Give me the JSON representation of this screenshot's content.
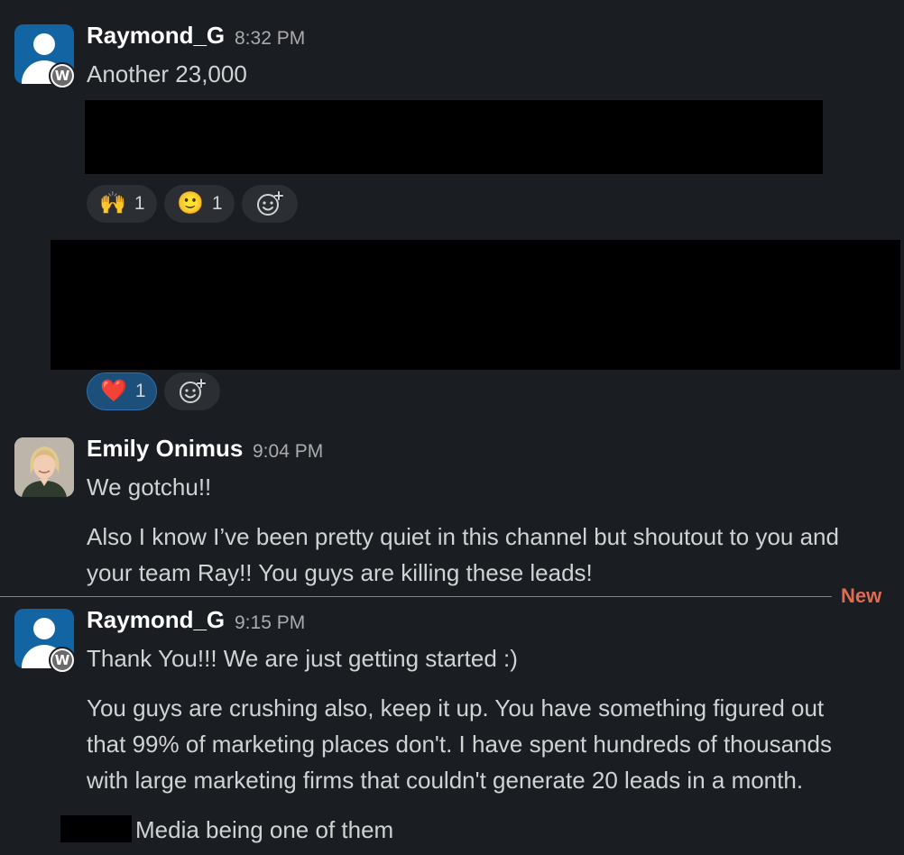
{
  "messages": [
    {
      "author": "Raymond_G",
      "time": "8:32 PM",
      "badge": "W",
      "lines": [
        "Another 23,000"
      ],
      "reactions": [
        {
          "emoji": "🙌",
          "count": "1"
        },
        {
          "emoji": "🙂",
          "count": "1"
        }
      ]
    },
    {
      "reactions": [
        {
          "emoji": "❤️",
          "count": "1"
        }
      ]
    },
    {
      "author": "Emily Onimus",
      "time": "9:04 PM",
      "lines": [
        "We gotchu!!",
        "Also I know I’ve been pretty quiet in this channel but shoutout to you and",
        "your team Ray!! You guys are killing these leads!"
      ]
    },
    {
      "author": "Raymond_G",
      "time": "9:15 PM",
      "badge": "W",
      "lines": [
        "Thank You!!! We are just getting started :)",
        "You guys are crushing also, keep it up. You have something figured out",
        "that 99% of marketing places don't. I have spent hundreds of thousands",
        "with large marketing firms that couldn't generate 20 leads in a month.",
        "Media being one of them"
      ]
    }
  ],
  "divider": {
    "label": "New"
  },
  "colors": {
    "background": "#1a1d21",
    "accent_blue": "#1264a3",
    "new_divider": "#e06b4f"
  },
  "icons": {
    "add_reaction": "add-reaction-icon",
    "guest_badge": "guest-badge-icon"
  }
}
